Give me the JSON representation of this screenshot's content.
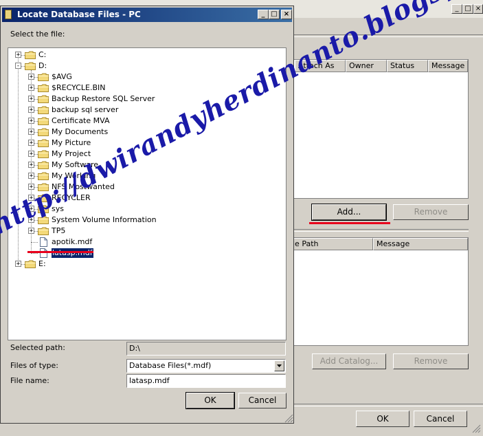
{
  "background_window": {
    "upper_columns": [
      "Attach As",
      "Owner",
      "Status",
      "Message"
    ],
    "add_label": "Add...",
    "remove_label": "Remove",
    "lower_columns": [
      "le Path",
      "Message"
    ],
    "add_catalog_label": "Add Catalog...",
    "remove2_label": "Remove",
    "ok_label": "OK",
    "cancel_label": "Cancel"
  },
  "dialog": {
    "title": "Locate Database Files - PC",
    "prompt": "Select the file:",
    "tree": [
      {
        "label": "C:",
        "type": "drive",
        "level": 0,
        "expander": "+"
      },
      {
        "label": "D:",
        "type": "drive",
        "level": 0,
        "expander": "-"
      },
      {
        "label": "$AVG",
        "type": "folder",
        "level": 1,
        "expander": "+"
      },
      {
        "label": "$RECYCLE.BIN",
        "type": "folder",
        "level": 1,
        "expander": "+"
      },
      {
        "label": "Backup Restore SQL Server",
        "type": "folder",
        "level": 1,
        "expander": "+"
      },
      {
        "label": "backup sql server",
        "type": "folder",
        "level": 1,
        "expander": "+"
      },
      {
        "label": "Certificate MVA",
        "type": "folder",
        "level": 1,
        "expander": "+"
      },
      {
        "label": "My Documents",
        "type": "folder",
        "level": 1,
        "expander": "+"
      },
      {
        "label": "My Picture",
        "type": "folder",
        "level": 1,
        "expander": "+"
      },
      {
        "label": "My Project",
        "type": "folder",
        "level": 1,
        "expander": "+"
      },
      {
        "label": "My Software",
        "type": "folder",
        "level": 1,
        "expander": "+"
      },
      {
        "label": "My Working",
        "type": "folder",
        "level": 1,
        "expander": "+"
      },
      {
        "label": "NFS Mostwanted",
        "type": "folder",
        "level": 1,
        "expander": "+"
      },
      {
        "label": "RECYCLER",
        "type": "folder",
        "level": 1,
        "expander": "+"
      },
      {
        "label": "sys",
        "type": "folder",
        "level": 1,
        "expander": "+"
      },
      {
        "label": "System Volume Information",
        "type": "folder",
        "level": 1,
        "expander": "+"
      },
      {
        "label": "TP5",
        "type": "folder",
        "level": 1,
        "expander": "+"
      },
      {
        "label": "apotik.mdf",
        "type": "file",
        "level": 1,
        "expander": ""
      },
      {
        "label": "latasp.mdf",
        "type": "file",
        "level": 1,
        "expander": "",
        "selected": true
      },
      {
        "label": "E:",
        "type": "drive",
        "level": 0,
        "expander": "+"
      }
    ],
    "selected_path_label": "Selected path:",
    "selected_path_value": "D:\\",
    "files_of_type_label": "Files of type:",
    "files_of_type_value": "Database Files(*.mdf)",
    "file_name_label": "File name:",
    "file_name_value": "latasp.mdf",
    "ok_label": "OK",
    "cancel_label": "Cancel"
  },
  "watermark": "http://dwirandyherdinanto.blogspot.com/",
  "colors": {
    "title_bar": "#0a246a",
    "selection": "#0a246a",
    "annotation_underline": "#e8001c",
    "watermark": "#1a1aa8"
  },
  "icons": [
    "folder-icon",
    "file-icon",
    "drive-icon",
    "minimize-icon",
    "maximize-icon",
    "close-icon",
    "dropdown-arrow-icon",
    "size-grip-icon"
  ]
}
